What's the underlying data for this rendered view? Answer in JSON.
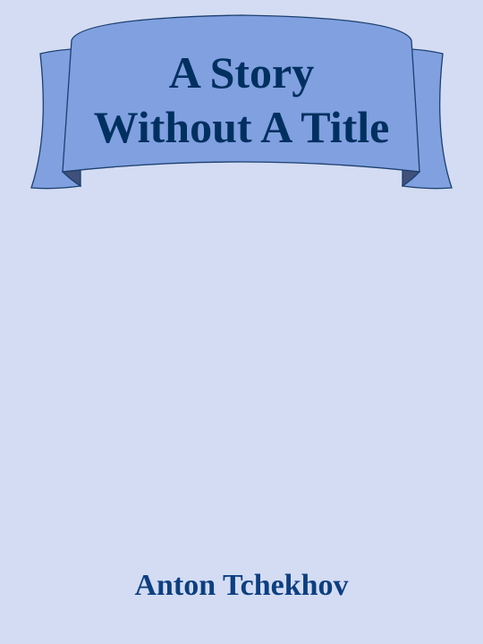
{
  "cover": {
    "title_lines": [
      "A Story",
      "Without A Title"
    ],
    "author": "Anton Tchekhov",
    "colors": {
      "background": "#d3dcf3",
      "banner_fill": "#80a0e0",
      "banner_stroke": "#1c3f6e",
      "banner_fold": "#40507a",
      "title_text": "#003060",
      "author_text": "#0d3f80"
    }
  }
}
